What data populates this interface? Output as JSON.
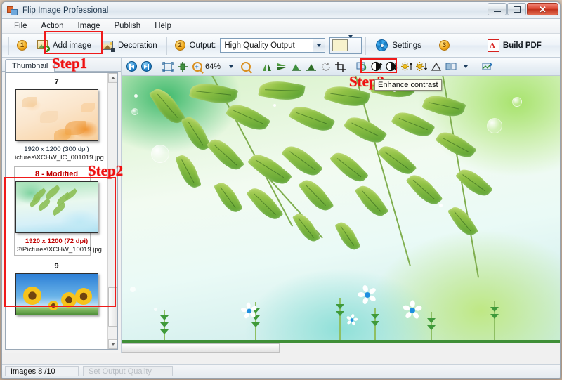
{
  "window": {
    "title": "Flip Image Professional",
    "controls": {
      "minimize": "–",
      "maximize": "□",
      "close": "✕"
    }
  },
  "menubar": {
    "items": [
      "File",
      "Action",
      "Image",
      "Publish",
      "Help"
    ]
  },
  "toolbar": {
    "badge1": "1",
    "add_image_label": "Add image",
    "decoration_label": "Decoration",
    "badge2": "2",
    "output_label": "Output:",
    "output_value": "High Quality Output",
    "color_swatch": "#f7f2cd",
    "settings_label": "Settings",
    "badge3": "3",
    "build_pdf_label": "Build PDF"
  },
  "image_toolbar": {
    "zoom_value": "64%",
    "buttons": [
      "first-image",
      "next-image",
      "fit-page",
      "fit-width",
      "zoom-in",
      "zoom-out",
      "flip-horizontal",
      "flip-vertical",
      "rotate-left",
      "rotate-right",
      "rotate-free",
      "crop",
      "restore",
      "contrast-increase",
      "contrast-decrease",
      "brightness-increase",
      "brightness-decrease",
      "sharpen",
      "split-view",
      "reset-image"
    ]
  },
  "tooltip": {
    "text": "Enhance contrast"
  },
  "sidebar": {
    "tab_label": "Thumbnail",
    "items": [
      {
        "number": "7",
        "modified": false,
        "dimensions": "1920 x 1200 (300 dpi)",
        "path": "...ictures\\XCHW_IC_001019.jpg",
        "selected": false
      },
      {
        "number": "8 - Modified",
        "modified": true,
        "dimensions": "1920 x 1200 (72 dpi)",
        "path": "...3\\Pictures\\XCHW_10019.jpg",
        "selected": true
      },
      {
        "number": "9",
        "modified": false,
        "dimensions": "",
        "path": "",
        "selected": false
      }
    ]
  },
  "statusbar": {
    "images_count": "Images 8 /10",
    "secondary": "Set Output Quality"
  },
  "annotations": {
    "step1": "Step1",
    "step2": "Step2",
    "step3": "Step3"
  },
  "colors": {
    "annotation_red": "#ef1a1a",
    "accent_blue": "#1f7fc8",
    "badge_gold": "#f0a91c"
  }
}
